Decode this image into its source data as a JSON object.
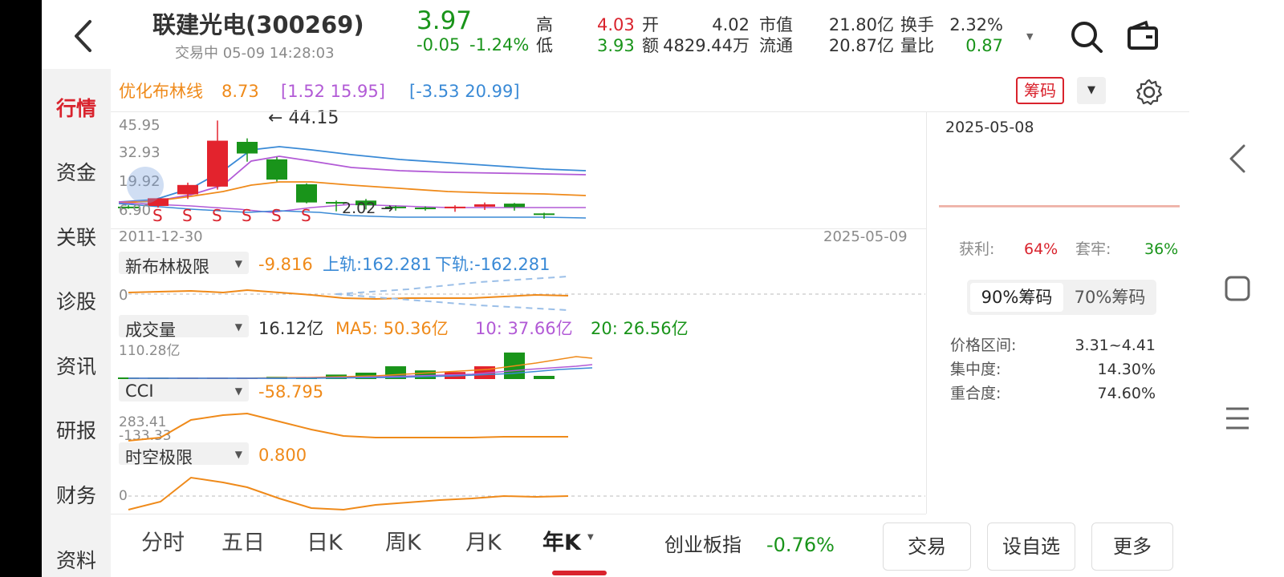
{
  "header": {
    "stock_name": "联建光电(300269)",
    "status_time": "交易中 05-09 14:28:03",
    "price": "3.97",
    "change": "-0.05",
    "change_pct": "-1.24%",
    "high_label": "高",
    "high_value": "4.03",
    "low_label": "低",
    "low_value": "3.93",
    "open_label": "开",
    "open_value": "4.02",
    "amount_label": "额",
    "amount_value": "4829.44万",
    "mcap_label": "市值",
    "mcap_value": "21.80亿",
    "float_label": "流通",
    "float_value": "20.87亿",
    "turnover_label": "换手",
    "turnover_value": "2.32%",
    "vol_ratio_label": "量比",
    "vol_ratio_value": "0.87"
  },
  "sidenav": {
    "items": [
      {
        "label": "行情",
        "active": true
      },
      {
        "label": "资金"
      },
      {
        "label": "关联"
      },
      {
        "label": "诊股"
      },
      {
        "label": "资讯"
      },
      {
        "label": "研报"
      },
      {
        "label": "财务"
      },
      {
        "label": "资料"
      }
    ]
  },
  "main_chart": {
    "indicator_name": "优化布林线",
    "indicator_value": "8.73",
    "range1": "[1.52  15.95]",
    "range2": "[-3.53  20.99]",
    "chips_button": "筹码",
    "y_labels": [
      "45.95",
      "32.93",
      "19.92",
      "6.90"
    ],
    "high_marker": "44.15",
    "low_marker": "2.02",
    "signal_letter": "S",
    "start_date": "2011-12-30",
    "end_date": "2025-05-09"
  },
  "panels": {
    "bollinger": {
      "name": "新布林极限",
      "value": "-9.816",
      "upper": "上轨:162.281",
      "lower": "下轨:-162.281",
      "zero": "0"
    },
    "volume": {
      "name": "成交量",
      "value": "16.12亿",
      "ma5": "MA5: 50.36亿",
      "ma10": "10: 37.66亿",
      "ma20": "20: 26.56亿",
      "ymax": "110.28亿"
    },
    "cci": {
      "name": "CCI",
      "value": "-58.795",
      "label_a": "283.41",
      "label_b": "-133.33"
    },
    "spacetime": {
      "name": "时空极限",
      "value": "0.800",
      "zero": "0"
    }
  },
  "chips": {
    "date": "2025-05-08",
    "profit_label": "获利:",
    "profit_value": "64%",
    "trapped_label": "套牢:",
    "trapped_value": "36%",
    "tab90": "90%筹码",
    "tab70": "70%筹码",
    "price_range_label": "价格区间:",
    "price_range_value": "3.31~4.41",
    "concentration_label": "集中度:",
    "concentration_value": "14.30%",
    "overlap_label": "重合度:",
    "overlap_value": "74.60%"
  },
  "bottom": {
    "tabs": [
      "分时",
      "五日",
      "日K",
      "周K",
      "月K",
      "年K"
    ],
    "active_tab": "年K",
    "index_name": "创业板指",
    "index_change": "-0.76%",
    "trade_button": "交易",
    "watchlist_button": "设自选",
    "more_button": "更多"
  },
  "chart_data": {
    "type": "candlestick",
    "candles": [
      {
        "o": 6.9,
        "h": 7.8,
        "l": 6.3,
        "c": 7.2,
        "dir": "down"
      },
      {
        "o": 7.5,
        "h": 9.5,
        "l": 6.8,
        "c": 10.8,
        "dir": "up"
      },
      {
        "o": 12.5,
        "h": 17.5,
        "l": 10.5,
        "c": 16.5,
        "dir": "up"
      },
      {
        "o": 15.8,
        "h": 44.15,
        "l": 14.5,
        "c": 35.5,
        "dir": "up"
      },
      {
        "o": 35.0,
        "h": 36.5,
        "l": 26.5,
        "c": 30.0,
        "dir": "down"
      },
      {
        "o": 27.5,
        "h": 28.5,
        "l": 18.0,
        "c": 18.8,
        "dir": "down"
      },
      {
        "o": 16.8,
        "h": 17.2,
        "l": 8.6,
        "c": 9.0,
        "dir": "down"
      },
      {
        "o": 9.2,
        "h": 9.8,
        "l": 5.2,
        "c": 8.6,
        "dir": "down"
      },
      {
        "o": 9.8,
        "h": 10.5,
        "l": 6.0,
        "c": 7.8,
        "dir": "down"
      },
      {
        "o": 7.2,
        "h": 7.6,
        "l": 5.5,
        "c": 7.0,
        "dir": "down"
      },
      {
        "o": 6.8,
        "h": 7.3,
        "l": 5.5,
        "c": 6.6,
        "dir": "down"
      },
      {
        "o": 6.5,
        "h": 7.8,
        "l": 5.0,
        "c": 7.2,
        "dir": "up"
      },
      {
        "o": 7.2,
        "h": 9.0,
        "l": 5.8,
        "c": 8.2,
        "dir": "up"
      },
      {
        "o": 8.5,
        "h": 8.8,
        "l": 5.5,
        "c": 7.0,
        "dir": "down"
      },
      {
        "o": 4.3,
        "h": 4.6,
        "l": 2.02,
        "c": 4.0,
        "dir": "down"
      }
    ],
    "volume": [
      {
        "v": 4,
        "dir": "down"
      },
      {
        "v": 3,
        "dir": "up"
      },
      {
        "v": 3,
        "dir": "up"
      },
      {
        "v": 5,
        "dir": "up"
      },
      {
        "v": 7,
        "dir": "down"
      },
      {
        "v": 5,
        "dir": "down"
      },
      {
        "v": 14,
        "dir": "down"
      },
      {
        "v": 20,
        "dir": "down"
      },
      {
        "v": 40,
        "dir": "down"
      },
      {
        "v": 27,
        "dir": "down"
      },
      {
        "v": 22,
        "dir": "up"
      },
      {
        "v": 40,
        "dir": "up"
      },
      {
        "v": 83,
        "dir": "down"
      },
      {
        "v": 10,
        "dir": "down"
      }
    ]
  },
  "colors": {
    "up": "#e3232d",
    "down": "#19941a",
    "accent": "#d9232d",
    "orange": "#ef8a1a",
    "purple": "#b25ad6",
    "blue": "#3a8ad6"
  }
}
